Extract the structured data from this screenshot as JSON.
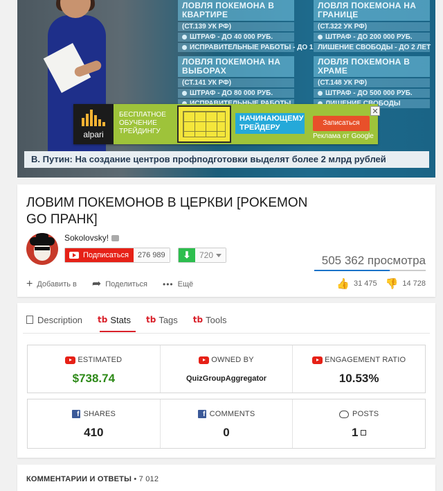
{
  "video": {
    "board_left": [
      {
        "head": "ЛОВЛЯ ПОКЕМОНА В КВАРТИРЕ",
        "lines": [
          "(СТ.139 УК РФ)",
          "ШТРАФ - ДО 40 000 РУБ.",
          "ИСПРАВИТЕЛЬНЫЕ РАБОТЫ - ДО 1"
        ]
      },
      {
        "head": "ЛОВЛЯ ПОКЕМОНА НА ВЫБОРАХ",
        "lines": [
          "(СТ.141 УК РФ)",
          "ШТРАФ - ДО 80 000 РУБ.",
          "ИСПРАВИТЕЛЬНЫЕ РАБОТЫ"
        ]
      }
    ],
    "board_right": [
      {
        "head": "ЛОВЛЯ ПОКЕМОНА НА ГРАНИЦЕ",
        "lines": [
          "(СТ.322 УК РФ)",
          "ШТРАФ - ДО 200 000 РУБ.",
          "ЛИШЕНИЕ СВОБОДЫ - ДО 2 ЛЕТ"
        ]
      },
      {
        "head": "ЛОВЛЯ ПОКЕМОНА В ХРАМЕ",
        "lines": [
          "(СТ.148 УК РФ)",
          "ШТРАФ - ДО 500 000 РУБ.",
          "ЛИШЕНИЕ СВОБОДЫ"
        ]
      }
    ],
    "ticker": "В. Путин: На создание центров профподготовки выделят более 2 млрд рублей",
    "ad": {
      "brand": "alpari",
      "left_text": "БЕСПЛАТНОЕ ОБУЧЕНИЕ ТРЕЙДИНГУ",
      "mid_text": "НАЧИНАЮЩЕМУ ТРЕЙДЕРУ",
      "cta": "Записаться",
      "note": "Реклама от Google",
      "close": "✕"
    }
  },
  "info": {
    "title": "ЛОВИМ ПОКЕМОНОВ В ЦЕРКВИ [POKEMON GO ПРАНК]",
    "channel": "Sokolovsky!",
    "subscribe_label": "Подписаться",
    "subscriber_count": "276 989",
    "download_count": "720",
    "views": "505 362 просмотра",
    "actions": {
      "add": "Добавить в",
      "share": "Поделиться",
      "more": "Ещё"
    },
    "likes": "31 475",
    "dislikes": "14 728",
    "like_ratio": 0.68
  },
  "stats": {
    "tabs": [
      {
        "label": "Description",
        "active": false
      },
      {
        "label": "Stats",
        "active": true
      },
      {
        "label": "Tags",
        "active": false
      },
      {
        "label": "Tools",
        "active": false
      }
    ],
    "top": [
      {
        "label": "ESTIMATED",
        "value": "$738.74"
      },
      {
        "label": "OWNED BY",
        "value": "QuizGroupAggregator"
      },
      {
        "label": "ENGAGEMENT RATIO",
        "value": "10.53%"
      }
    ],
    "bottom": [
      {
        "label": "SHARES",
        "value": "410"
      },
      {
        "label": "COMMENTS",
        "value": "0"
      },
      {
        "label": "POSTS",
        "value": "1"
      }
    ]
  },
  "comments": {
    "label": "КОММЕНТАРИИ И ОТВЕТЫ",
    "count": "• 7 012"
  },
  "colors": {
    "youtube_red": "#e62117",
    "money_green": "#2e8a19",
    "facebook_blue": "#3b5998",
    "view_bar_blue": "#1a73c9"
  }
}
